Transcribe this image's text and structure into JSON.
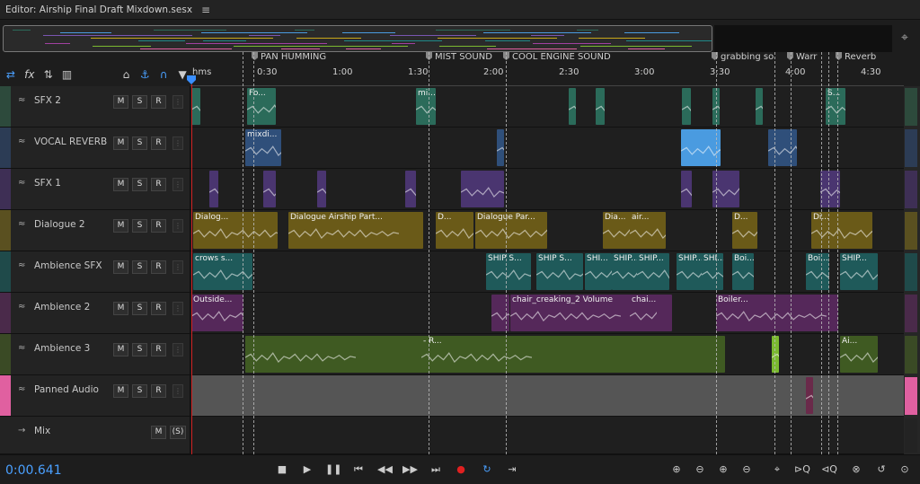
{
  "editor": {
    "title": "Editor: Airship Final Draft Mixdown.sesx",
    "menu_icon": "hamburger-icon"
  },
  "markers": [
    {
      "label": "PAN HUMMING"
    },
    {
      "label": "MIST SOUND"
    },
    {
      "label": "COOL ENGINE SOUND"
    },
    {
      "label": "grabbing so"
    },
    {
      "label": "Warr"
    },
    {
      "label": "Reverb"
    }
  ],
  "ruler": {
    "ticks": [
      "hms",
      "0:30",
      "1:00",
      "1:30",
      "2:00",
      "2:30",
      "3:00",
      "3:30",
      "4:00",
      "4:30"
    ]
  },
  "tools": [
    {
      "icon": "swap-icon",
      "label": "⇄"
    },
    {
      "icon": "fx-icon",
      "label": "fx"
    },
    {
      "icon": "sends-icon",
      "label": "⇅"
    },
    {
      "icon": "meter-icon",
      "label": "▥"
    },
    {
      "icon": "metronome-icon",
      "label": "⌂"
    },
    {
      "icon": "snap-icon",
      "label": "⚓"
    },
    {
      "icon": "magnet-icon",
      "label": "∩"
    },
    {
      "icon": "marker-icon",
      "label": "▼"
    }
  ],
  "tracks": [
    {
      "name": "SFX 2",
      "color": "#2d4a3c",
      "m": "M",
      "s": "S",
      "r": "R",
      "clips": [
        {
          "label": "",
          "color": "#2b6b5a"
        },
        {
          "label": "Fo...",
          "color": "#2b6b5a"
        },
        {
          "label": "mi...",
          "color": "#2b6b5a"
        },
        {
          "label": "",
          "color": "#2b6b5a"
        },
        {
          "label": "",
          "color": "#2b6b5a"
        },
        {
          "label": "",
          "color": "#2b6b5a"
        },
        {
          "label": "",
          "color": "#2b6b5a"
        },
        {
          "label": "",
          "color": "#2b6b5a"
        },
        {
          "label": "S...",
          "color": "#2b6b5a"
        }
      ]
    },
    {
      "name": "VOCAL REVERB",
      "color": "#2c3c55",
      "m": "M",
      "s": "S",
      "r": "R",
      "clips": [
        {
          "label": "mixdi...",
          "color": "#2f4f7a"
        },
        {
          "label": "",
          "color": "#2f4f7a"
        },
        {
          "label": "",
          "color": "#4a9be0"
        },
        {
          "label": "",
          "color": "#2f4f7a"
        }
      ]
    },
    {
      "name": "SFX 1",
      "color": "#3e2f55",
      "m": "M",
      "s": "S",
      "r": "R",
      "clips": [
        {
          "label": "",
          "color": "#4a3570"
        },
        {
          "label": "",
          "color": "#4a3570"
        },
        {
          "label": "",
          "color": "#4a3570"
        },
        {
          "label": "",
          "color": "#4a3570"
        },
        {
          "label": "",
          "color": "#4a3570"
        },
        {
          "label": "",
          "color": "#4a3570"
        },
        {
          "label": "",
          "color": "#4a3570"
        },
        {
          "label": "",
          "color": "#4a3570"
        }
      ]
    },
    {
      "name": "Dialogue 2",
      "color": "#5a5020",
      "m": "M",
      "s": "S",
      "r": "R",
      "clips": [
        {
          "label": "Dialog...",
          "color": "#6a5a18"
        },
        {
          "label": "Dialogue Airship Part...",
          "color": "#6a5a18"
        },
        {
          "label": "D...",
          "color": "#6a5a18"
        },
        {
          "label": "Dialogue Par...",
          "color": "#6a5a18"
        },
        {
          "label": "Dia...",
          "color": "#6a5a18"
        },
        {
          "label": "air...",
          "color": "#6a5a18"
        },
        {
          "label": "D...",
          "color": "#6a5a18"
        },
        {
          "label": "Di...",
          "color": "#6a5a18"
        }
      ]
    },
    {
      "name": "Ambience SFX",
      "color": "#1f4a4a",
      "m": "M",
      "s": "S",
      "r": "R",
      "clips": [
        {
          "label": "crows s...",
          "color": "#1f5a5a"
        },
        {
          "label": "SHIP S...",
          "color": "#1f5a5a"
        },
        {
          "label": "SHIP S...",
          "color": "#1f5a5a"
        },
        {
          "label": "SHI...",
          "color": "#1f5a5a"
        },
        {
          "label": "SHIP...",
          "color": "#1f5a5a"
        },
        {
          "label": "SHIP...",
          "color": "#1f5a5a"
        },
        {
          "label": "SHIP...",
          "color": "#1f5a5a"
        },
        {
          "label": "SHI...",
          "color": "#1f5a5a"
        },
        {
          "label": "Boi...",
          "color": "#1f5a5a"
        },
        {
          "label": "Boi...",
          "color": "#1f5a5a"
        },
        {
          "label": "SHIP...",
          "color": "#1f5a5a"
        }
      ]
    },
    {
      "name": "Ambience 2",
      "color": "#4a2a4a",
      "m": "M",
      "s": "S",
      "r": "R",
      "clips": [
        {
          "label": "Outside...",
          "color": "#55285a"
        },
        {
          "label": "",
          "color": "#55285a"
        },
        {
          "label": "chair_creaking_2   Volume",
          "color": "#55285a"
        },
        {
          "label": "chai...",
          "color": "#55285a"
        },
        {
          "label": "Boiler...",
          "color": "#55285a"
        }
      ]
    },
    {
      "name": "Ambience 3",
      "color": "#3a4a25",
      "m": "M",
      "s": "S",
      "r": "R",
      "clips": [
        {
          "label": "",
          "color": "#3f5a22"
        },
        {
          "label": "- R...",
          "color": "#3f5a22"
        },
        {
          "label": "",
          "color": "#7ab830"
        },
        {
          "label": "Ai...",
          "color": "#3f5a22"
        }
      ]
    },
    {
      "name": "Panned Audio",
      "color": "#e060a0",
      "m": "M",
      "s": "S",
      "r": "R",
      "clips": [
        {
          "label": "",
          "color": "#6a2a4a"
        }
      ]
    },
    {
      "name": "Mix",
      "color": "#232323",
      "m": "M",
      "s": "(S)",
      "r": "",
      "clips": []
    }
  ],
  "transport": {
    "timecode": "0:00.641",
    "buttons": [
      "stop-icon",
      "play-icon",
      "pause-icon",
      "to-start-icon",
      "rewind-icon",
      "fast-forward-icon",
      "to-end-icon",
      "record-icon",
      "loop-icon",
      "skip-icon"
    ]
  },
  "colors": {
    "accent": "#4aa0ff",
    "playhead": "#d02020",
    "record": "#e02020"
  }
}
